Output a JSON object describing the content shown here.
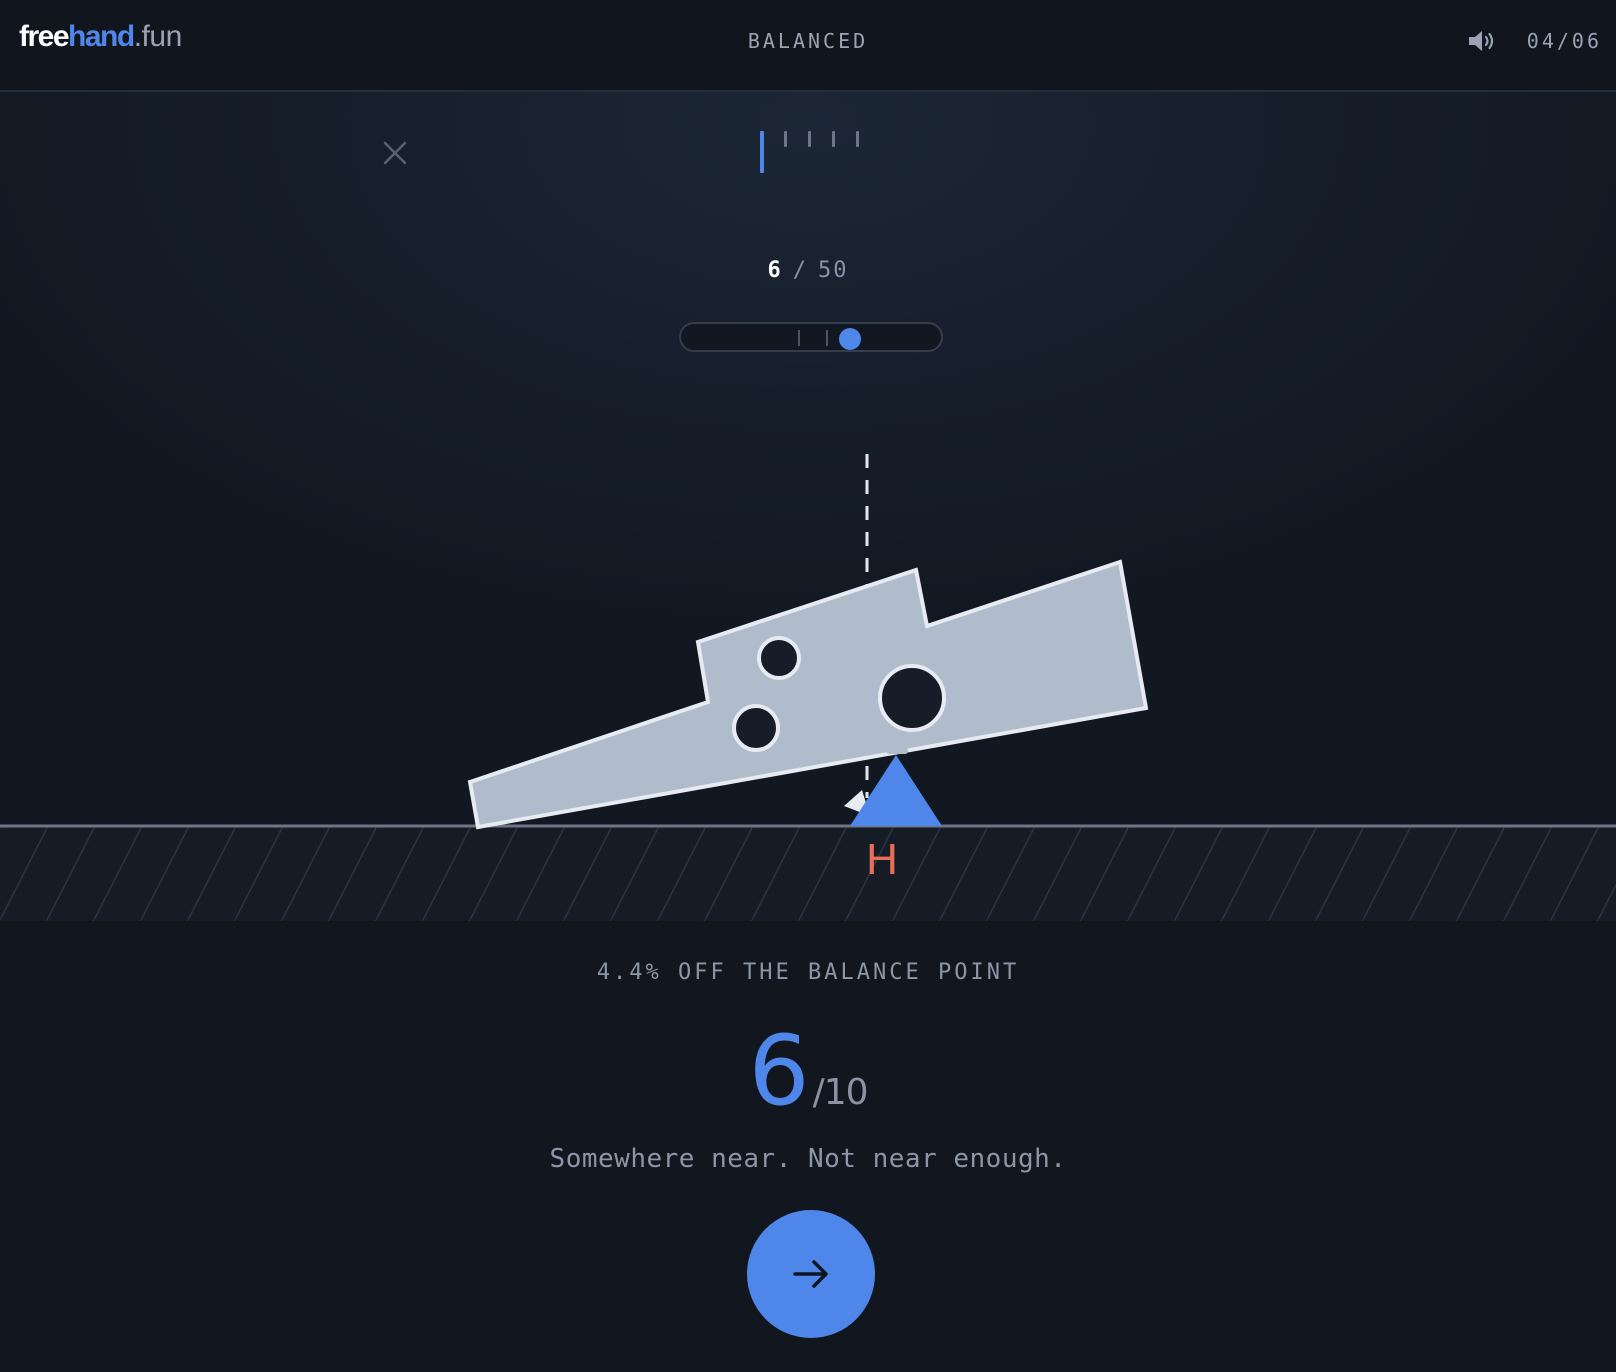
{
  "header": {
    "logo": {
      "part1": "free",
      "part2": "hand",
      "part3": ".fun"
    },
    "game_title": "BALANCED",
    "round_counter": "04/06",
    "sound_icon": "speaker-icon"
  },
  "progress": {
    "total_steps": 5,
    "current_step": 1
  },
  "attempts": {
    "current": "6",
    "separator": "/",
    "total": "50"
  },
  "slider": {
    "value_fraction": 0.62
  },
  "pivot_label": "H",
  "result": {
    "offset_text": "4.4% OFF THE BALANCE POINT",
    "score": "6",
    "score_max": "/10",
    "verdict": "Somewhere near. Not near enough."
  },
  "colors": {
    "accent": "#4f86ea",
    "shape_fill": "#b0bccb",
    "pivot_label": "#ea6d59",
    "background": "#11161f"
  },
  "icons": {
    "close": "close-icon",
    "next": "arrow-right-icon"
  }
}
